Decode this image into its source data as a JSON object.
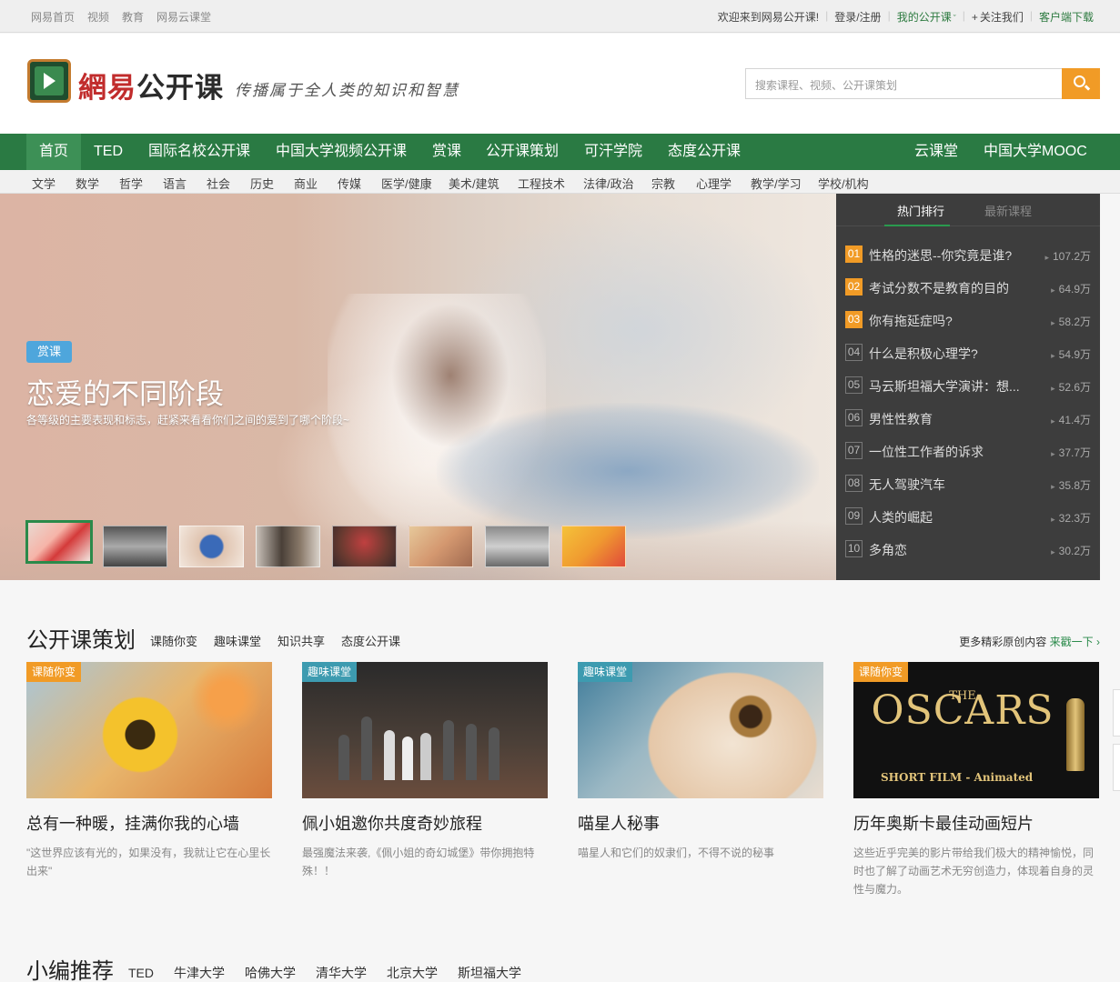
{
  "topbar": {
    "left_links": [
      "网易首页",
      "视频",
      "教育",
      "网易云课堂"
    ],
    "welcome": "欢迎来到网易公开课!",
    "login": "登录/注册",
    "my_open_course": "我的公开课",
    "follow": "关注我们",
    "client_download": "客户端下载"
  },
  "header": {
    "logo_red": "網易",
    "logo_dark": "公开课",
    "slogan": "传播属于全人类的知识和智慧",
    "search_placeholder": "搜索课程、视频、公开课策划"
  },
  "nav": {
    "items": [
      "首页",
      "TED",
      "国际名校公开课",
      "中国大学视频公开课",
      "赏课",
      "公开课策划",
      "可汗学院",
      "态度公开课"
    ],
    "right_items": [
      "云课堂",
      "中国大学MOOC"
    ]
  },
  "subnav": [
    "文学",
    "数学",
    "哲学",
    "语言",
    "社会",
    "历史",
    "商业",
    "传媒",
    "医学/健康",
    "美术/建筑",
    "工程技术",
    "法律/政治",
    "宗教",
    "心理学",
    "教学/学习",
    "学校/机构"
  ],
  "banner": {
    "tag": "赏课",
    "title": "恋爱的不同阶段",
    "subtitle": "各等级的主要表现和标志，赶紧来看看你们之间的爱到了哪个阶段~"
  },
  "hot": {
    "tabs": [
      "热门排行",
      "最新课程"
    ],
    "items": [
      {
        "num": "01",
        "title": "性格的迷思--你究竟是谁?",
        "count": "107.2万"
      },
      {
        "num": "02",
        "title": "考试分数不是教育的目的",
        "count": "64.9万"
      },
      {
        "num": "03",
        "title": "你有拖延症吗?",
        "count": "58.2万"
      },
      {
        "num": "04",
        "title": "什么是积极心理学?",
        "count": "54.9万"
      },
      {
        "num": "05",
        "title": "马云斯坦福大学演讲：想...",
        "count": "52.6万"
      },
      {
        "num": "06",
        "title": "男性性教育",
        "count": "41.4万"
      },
      {
        "num": "07",
        "title": "一位性工作者的诉求",
        "count": "37.7万"
      },
      {
        "num": "08",
        "title": "无人驾驶汽车",
        "count": "35.8万"
      },
      {
        "num": "09",
        "title": "人类的崛起",
        "count": "32.3万"
      },
      {
        "num": "10",
        "title": "多角恋",
        "count": "30.2万"
      }
    ]
  },
  "plan": {
    "title": "公开课策划",
    "tabs": [
      "课随你变",
      "趣味课堂",
      "知识共享",
      "态度公开课"
    ],
    "more_text": "更多精彩原创内容",
    "more_link": "来戳一下",
    "cards": [
      {
        "badge": "课随你变",
        "title": "总有一种暖，挂满你我的心墙",
        "desc": "\"这世界应该有光的，如果没有，我就让它在心里长出来\""
      },
      {
        "badge": "趣味课堂",
        "title": "佩小姐邀你共度奇妙旅程",
        "desc": "最强魔法来袭,《佩小姐的奇幻城堡》带你拥抱特殊！！"
      },
      {
        "badge": "趣味课堂",
        "title": "喵星人秘事",
        "desc": "喵星人和它们的奴隶们，不得不说的秘事"
      },
      {
        "badge": "课随你变",
        "title": "历年奥斯卡最佳动画短片",
        "desc": "这些近乎完美的影片带给我们极大的精神愉悦，同时也了解了动画艺术无穷创造力，体现着自身的灵性与魔力。",
        "img_the": "THE",
        "img_title": "OSCARS",
        "img_sub": "SHORT FILM - Animated"
      }
    ]
  },
  "recommend": {
    "title": "小编推荐",
    "tabs": [
      "TED",
      "牛津大学",
      "哈佛大学",
      "清华大学",
      "北京大学",
      "斯坦福大学"
    ]
  },
  "colors": {
    "brand_green": "#2a7a43",
    "accent_orange": "#f19b26",
    "hot_bg": "#3d3d3d"
  }
}
